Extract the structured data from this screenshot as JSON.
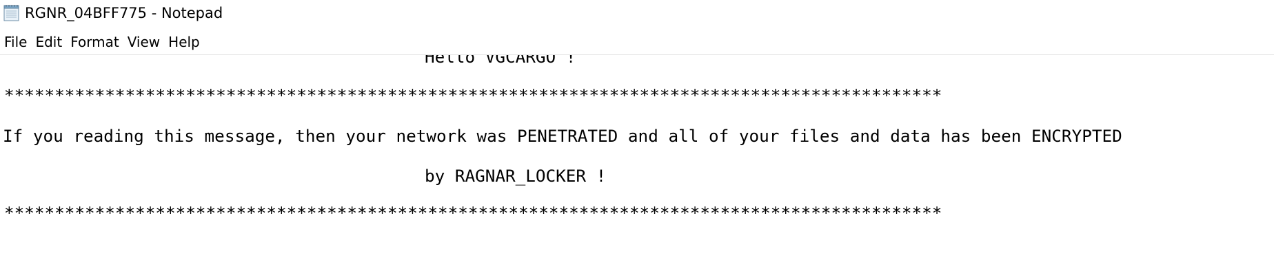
{
  "window": {
    "title": "RGNR_04BFF775 - Notepad",
    "icon": "notepad-icon"
  },
  "menu": {
    "items": [
      "File",
      "Edit",
      "Format",
      "View",
      "Help"
    ]
  },
  "document": {
    "lines": [
      "                       Hello VGCARGO !",
      "*********************************************************************************************",
      " If you reading this message, then your network was PENETRATED and all of your files and data has been ENCRYPTED",
      "                       by RAGNAR_LOCKER !",
      "*********************************************************************************************"
    ]
  }
}
